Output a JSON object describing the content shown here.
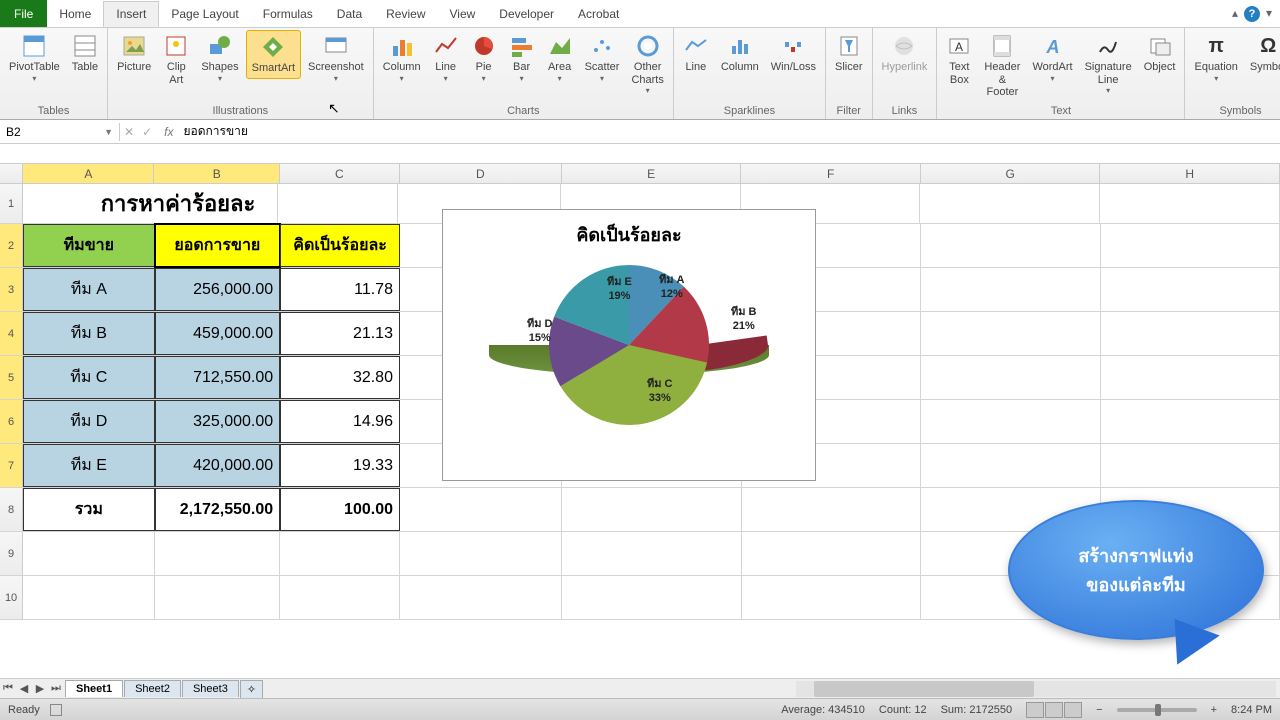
{
  "ribbon": {
    "file": "File",
    "tabs": [
      "Home",
      "Insert",
      "Page Layout",
      "Formulas",
      "Data",
      "Review",
      "View",
      "Developer",
      "Acrobat"
    ],
    "active_tab": "Insert",
    "groups": {
      "tables": {
        "label": "Tables",
        "items": [
          "PivotTable",
          "Table"
        ]
      },
      "illustrations": {
        "label": "Illustrations",
        "items": [
          "Picture",
          "Clip Art",
          "Shapes",
          "SmartArt",
          "Screenshot"
        ]
      },
      "charts": {
        "label": "Charts",
        "items": [
          "Column",
          "Line",
          "Pie",
          "Bar",
          "Area",
          "Scatter",
          "Other Charts"
        ]
      },
      "sparklines": {
        "label": "Sparklines",
        "items": [
          "Line",
          "Column",
          "Win/Loss"
        ]
      },
      "filter": {
        "label": "Filter",
        "items": [
          "Slicer"
        ]
      },
      "links": {
        "label": "Links",
        "items": [
          "Hyperlink"
        ]
      },
      "text": {
        "label": "Text",
        "items": [
          "Text Box",
          "Header & Footer",
          "WordArt",
          "Signature Line",
          "Object"
        ]
      },
      "symbols": {
        "label": "Symbols",
        "items": [
          "Equation",
          "Symbol"
        ]
      }
    }
  },
  "name_box": "B2",
  "formula": "ยอดการขาย",
  "columns": [
    "A",
    "B",
    "C",
    "D",
    "E",
    "F",
    "G",
    "H"
  ],
  "title": "การหาค่าร้อยละ",
  "headers": {
    "team": "ทีมขาย",
    "sales": "ยอดการขาย",
    "pct": "คิดเป็นร้อยละ"
  },
  "rows": [
    {
      "team": "ทีม A",
      "sales": "256,000.00",
      "pct": "11.78"
    },
    {
      "team": "ทีม B",
      "sales": "459,000.00",
      "pct": "21.13"
    },
    {
      "team": "ทีม C",
      "sales": "712,550.00",
      "pct": "32.80"
    },
    {
      "team": "ทีม D",
      "sales": "325,000.00",
      "pct": "14.96"
    },
    {
      "team": "ทีม E",
      "sales": "420,000.00",
      "pct": "19.33"
    }
  ],
  "total": {
    "label": "รวม",
    "sales": "2,172,550.00",
    "pct": "100.00"
  },
  "chart_data": {
    "type": "pie",
    "title": "คิดเป็นร้อยละ",
    "categories": [
      "ทีม A",
      "ทีม B",
      "ทีม C",
      "ทีม D",
      "ทีม E"
    ],
    "values": [
      12,
      21,
      33,
      15,
      19
    ],
    "labels": [
      {
        "name": "ทีม A",
        "pct": "12%"
      },
      {
        "name": "ทีม B",
        "pct": "21%"
      },
      {
        "name": "ทีม C",
        "pct": "33%"
      },
      {
        "name": "ทีม D",
        "pct": "15%"
      },
      {
        "name": "ทีม E",
        "pct": "19%"
      }
    ],
    "colors": [
      "#4a8fb8",
      "#b23a48",
      "#8fb03e",
      "#6a4a8a",
      "#3a9aa8"
    ]
  },
  "callout": {
    "line1": "สร้างกราฟแท่ง",
    "line2": "ของแต่ละทีม"
  },
  "sheets": [
    "Sheet1",
    "Sheet2",
    "Sheet3"
  ],
  "status": {
    "ready": "Ready",
    "avg": "Average: 434510",
    "count": "Count: 12",
    "sum": "Sum: 2172550",
    "time": "8:24 PM"
  }
}
